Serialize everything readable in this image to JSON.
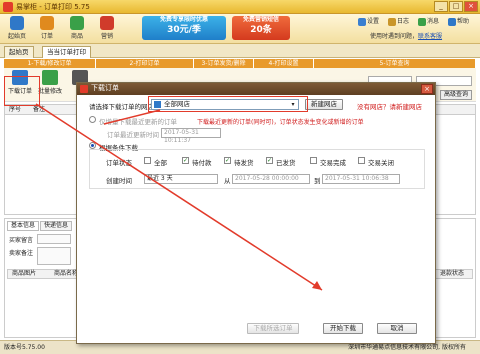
{
  "window": {
    "title": "易掌柜 - 订单打印 5.75",
    "min": "_",
    "max": "□",
    "close": "×"
  },
  "toolbar": {
    "items": [
      {
        "label": "起始页",
        "color": "#2f78c8"
      },
      {
        "label": "订单",
        "color": "#e08a1e"
      },
      {
        "label": "商品",
        "color": "#3aa048"
      },
      {
        "label": "营销",
        "color": "#d03b2b"
      }
    ],
    "promo1": {
      "small": "免费专享限时优惠",
      "big": "30元/季"
    },
    "promo2": {
      "small": "免费营销短信",
      "big": "20条"
    },
    "right": {
      "settings": "设置",
      "log": "日志",
      "messages": "消息",
      "help": "帮助",
      "note_prefix": "使用时遇到问题，",
      "note_link": "联系客服"
    }
  },
  "tabs": [
    "起始页",
    "当当订单打印"
  ],
  "steps": [
    "1-下载/修改订单",
    "2-打印订单",
    "3-订单发货/删除",
    "4-打印设置",
    "5-订单查询"
  ],
  "bgtools": {
    "download": "下载订单",
    "batch": "批量修改",
    "print": "打",
    "advanced": "高级查询"
  },
  "list_header": {
    "col1": "序号",
    "col2": "备注"
  },
  "bottom": {
    "tabs": [
      "基本信息",
      "快递信息"
    ],
    "buyer_msg": "买家留言",
    "seller_note": "卖家备注",
    "cols": {
      "name": "商品图片",
      "title": "商品名称",
      "status": "退款状态"
    }
  },
  "status": {
    "version": "版本号5.75.00",
    "company": "深圳市华通易点信息技术有限公司, 版权所有"
  },
  "dialog": {
    "title": "下载订单",
    "close": "×",
    "shop_label": "请选择下载订单的网店",
    "shop_value": "全部网店",
    "add_shop": "新建网店",
    "add_shop_link": "没有网店？请新建网店",
    "option1_label": "仅增量下载最近更新的订单",
    "option1_hint": "下载最近更新的订单(同时可)，订单状态发生变化或新增的订单",
    "last_update_label": "订单最近更新时间",
    "last_update_value": "2017-05-31 10:11:37",
    "option2_label": "根据条件下载",
    "status_label": "订单状态",
    "statuses": [
      {
        "label": "全部",
        "checked": false
      },
      {
        "label": "待付款",
        "checked": true
      },
      {
        "label": "待发货",
        "checked": true
      },
      {
        "label": "已发货",
        "checked": true
      },
      {
        "label": "交易完成",
        "checked": false
      },
      {
        "label": "交易关闭",
        "checked": false
      }
    ],
    "created_label": "创建时间",
    "range_value": "最近 3 天",
    "from_label": "从",
    "from_value": "2017-05-28 00:00:00",
    "to_label": "到",
    "to_value": "2017-05-31 10:06:38",
    "btn_start_disabled": "下载所选订单",
    "btn_start": "开始下载",
    "btn_cancel": "取消"
  }
}
